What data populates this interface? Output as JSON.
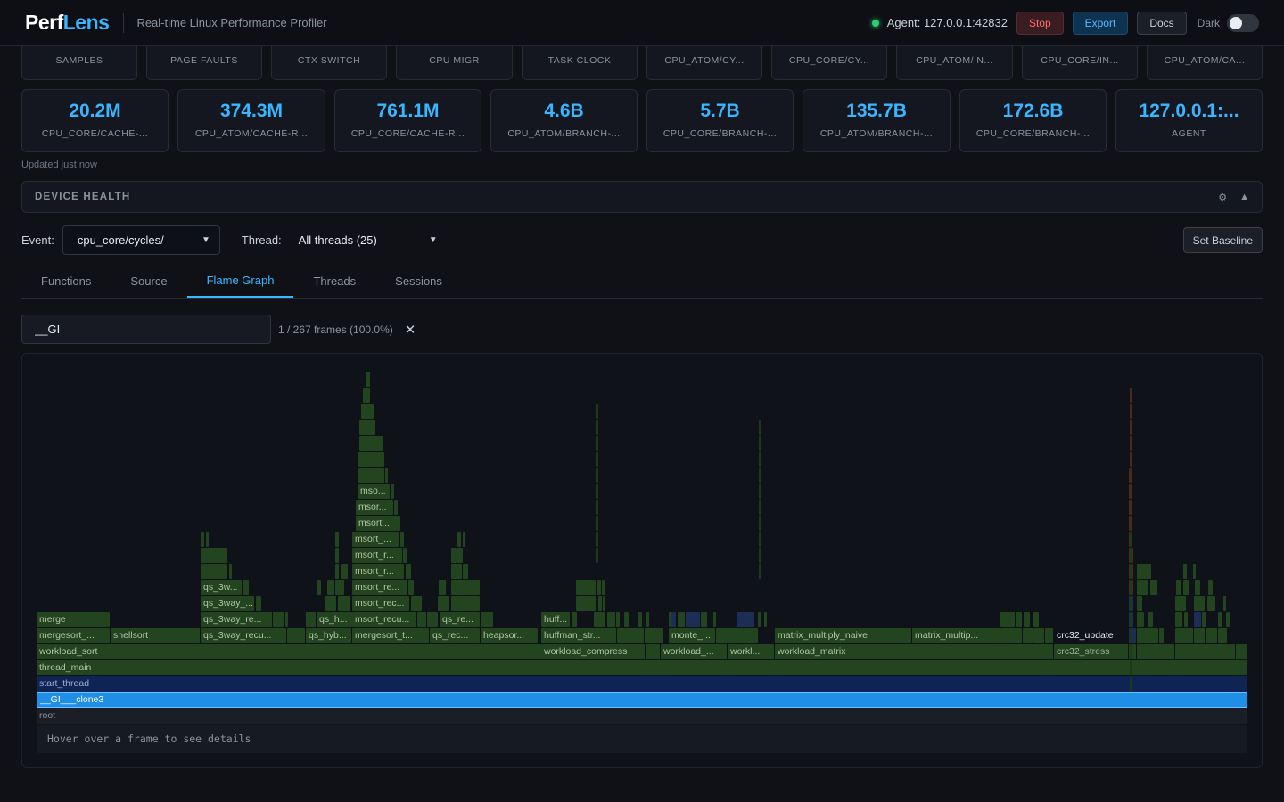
{
  "header": {
    "logo_main": "Perf",
    "logo_accent": "Lens",
    "tagline": "Real-time Linux Performance Profiler",
    "agent": "Agent: 127.0.0.1:42832",
    "stop": "Stop",
    "export": "Export",
    "docs": "Docs",
    "dark": "Dark"
  },
  "stats_row1": [
    {
      "label": "SAMPLES"
    },
    {
      "label": "PAGE FAULTS"
    },
    {
      "label": "CTX SWITCH"
    },
    {
      "label": "CPU MIGR"
    },
    {
      "label": "TASK CLOCK"
    },
    {
      "label": "CPU_ATOM/CY..."
    },
    {
      "label": "CPU_CORE/CY..."
    },
    {
      "label": "CPU_ATOM/IN..."
    },
    {
      "label": "CPU_CORE/IN..."
    },
    {
      "label": "CPU_ATOM/CA..."
    }
  ],
  "stats_row2": [
    {
      "value": "20.2M",
      "label": "CPU_CORE/CACHE-..."
    },
    {
      "value": "374.3M",
      "label": "CPU_ATOM/CACHE-R..."
    },
    {
      "value": "761.1M",
      "label": "CPU_CORE/CACHE-R..."
    },
    {
      "value": "4.6B",
      "label": "CPU_ATOM/BRANCH-..."
    },
    {
      "value": "5.7B",
      "label": "CPU_CORE/BRANCH-..."
    },
    {
      "value": "135.7B",
      "label": "CPU_ATOM/BRANCH-..."
    },
    {
      "value": "172.6B",
      "label": "CPU_CORE/BRANCH-..."
    },
    {
      "value": "127.0.0.1:...",
      "label": "AGENT"
    }
  ],
  "updated": "Updated just now",
  "device_health": {
    "title": "DEVICE HEALTH",
    "gear": "⚙",
    "collapse": "▲"
  },
  "controls": {
    "event_label": "Event:",
    "event_value": "cpu_core/cycles/",
    "thread_label": "Thread:",
    "thread_value": "All threads (25)",
    "baseline": "Set Baseline"
  },
  "tabs": [
    "Functions",
    "Source",
    "Flame Graph",
    "Threads",
    "Sessions"
  ],
  "search": {
    "value": "__GI",
    "count": "1 / 267 frames (100.0%)",
    "clear": "✕"
  },
  "flame": {
    "tip": "Hover over a frame to see details",
    "colors": {
      "green": "#22441f",
      "green_dark": "#1c3a1a",
      "match": "#1f8ee6",
      "start": "#0e2455",
      "root": "#1b1e26",
      "blue": "#1c2e55",
      "orange": "#4a2a1a"
    },
    "labels": {
      "root": "root",
      "clone3": "__GI___clone3",
      "start_thread": "start_thread",
      "thread_main": "thread_main",
      "workload_sort": "workload_sort",
      "workload_compress": "workload_compress",
      "workload_x": "workload_...",
      "workl": "workl...",
      "workload_matrix": "workload_matrix",
      "crc32_stress": "crc32_stress",
      "mergesort": "mergesort_...",
      "shellsort": "shellsort",
      "qs_3way_recu": "qs_3way_recu...",
      "qs_hyb": "qs_hyb...",
      "mergesort_t": "mergesort_t...",
      "qs_rec": "qs_rec...",
      "heapsor": "heapsor...",
      "huffman_str": "huffman_str...",
      "monte": "monte_...",
      "matrix_multiply_naive": "matrix_multiply_naive",
      "matrix_multip": "matrix_multip...",
      "crc32_update": "crc32_update",
      "merge": "merge",
      "qs_3way_re": "qs_3way_re...",
      "qs_h": "qs_h...",
      "msort_recu": "msort_recu...",
      "qs_re": "qs_re...",
      "huff": "huff...",
      "qs_3way_2": "qs_3way_...",
      "msort_rec": "msort_rec...",
      "qs_3w": "qs_3w...",
      "msort_re": "msort_re...",
      "msort_r1": "msort_r...",
      "msort_r2": "msort_r...",
      "msort_s": "msort_...",
      "msort_d": "msort...",
      "msor": "msor...",
      "mso": "mso..."
    }
  }
}
